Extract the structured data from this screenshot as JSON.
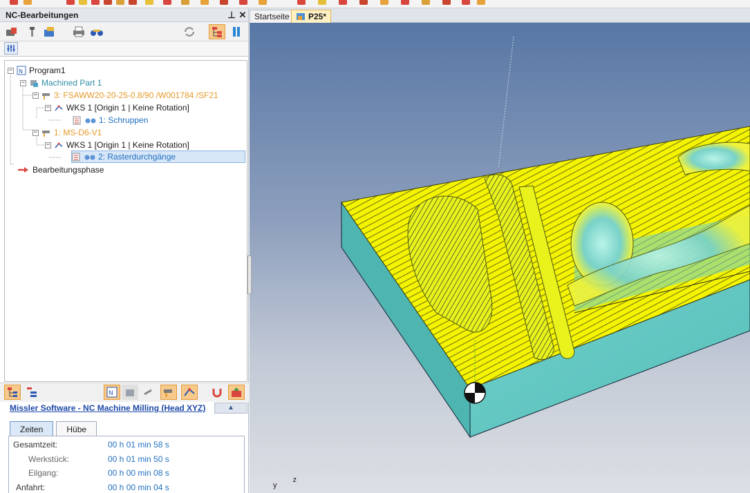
{
  "panel": {
    "title": "NC-Bearbeitungen",
    "pin_glyph": "⊥",
    "close_glyph": "✕"
  },
  "tree": {
    "items": [
      {
        "label": "Program1",
        "icon": "program-icon"
      },
      {
        "label": "Machined Part 1",
        "icon": "part-icon"
      },
      {
        "label": "3: FSAWW20-20-25-0.8/90 /W001784 /SF21",
        "icon": "tool-icon"
      },
      {
        "label": "WKS 1 [Origin 1 | Keine Rotation]",
        "icon": "coordinate-system-icon"
      },
      {
        "label": "1: Schruppen",
        "icon": "operation-icon"
      },
      {
        "label": "1: MS-D6-V1",
        "icon": "tool-icon"
      },
      {
        "label": "WKS 1 [Origin 1 | Keine Rotation]",
        "icon": "coordinate-system-icon"
      },
      {
        "label": "2: Rasterdurchgänge",
        "icon": "operation-icon"
      },
      {
        "label": "Bearbeitungsphase",
        "icon": "arrow-icon"
      }
    ],
    "expander_minus": "−"
  },
  "machine": {
    "link": "Missler Software - NC Machine Milling (Head XYZ)",
    "collapse_glyph": "▲"
  },
  "tabs": [
    {
      "label": "Zeiten",
      "active": true
    },
    {
      "label": "Hübe",
      "active": false
    }
  ],
  "times": [
    {
      "label": "Gesamtzeit:",
      "value": "00 h 01 min 58 s"
    },
    {
      "label": "Werkstück:",
      "value": "00 h 01 min 50 s"
    },
    {
      "label": "Eilgang:",
      "value": "00 h 00 min 08 s"
    },
    {
      "label": "Anfahrt:",
      "value": "00 h 00 min 04 s"
    }
  ],
  "doc_tabs": [
    {
      "label": "Startseite",
      "active": false
    },
    {
      "label": "P25*",
      "active": true
    }
  ],
  "axis": {
    "y": "y",
    "z": "z"
  },
  "colors": {
    "toolpath": "#ffff00",
    "stock": "#5cc8c3",
    "accent": "#e39a3a",
    "link": "#1d49a7"
  }
}
